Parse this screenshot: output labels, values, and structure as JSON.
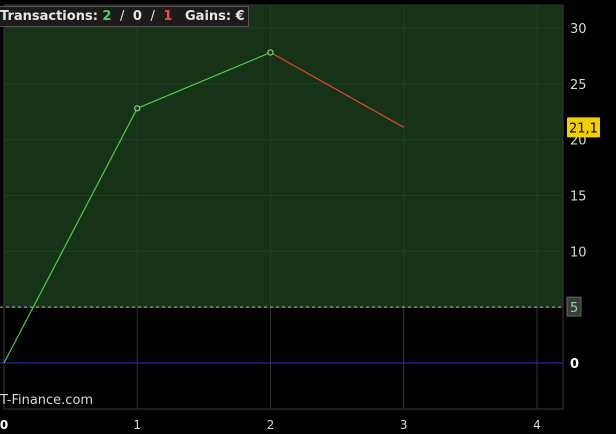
{
  "header": {
    "transactions_label": "Transactions:",
    "wins": "2",
    "neutral": "0",
    "losses": "1",
    "separator": "/",
    "gains_label": "Gains:",
    "gains_value": "€"
  },
  "watermark": "T-Finance.com",
  "chart_data": {
    "type": "line",
    "x": [
      0,
      1,
      2,
      3
    ],
    "y": [
      0,
      22.8,
      27.8,
      21.1
    ],
    "segment_colors": [
      "#4ccc4c",
      "#4ccc4c",
      "#e04a2a"
    ],
    "markers_at": [
      1,
      2
    ],
    "last_value_label": "21,1",
    "threshold": 5,
    "threshold_label": "5",
    "zero_line": 0,
    "xlim": [
      0,
      4.2
    ],
    "ylim": [
      -4.2,
      32
    ],
    "x_ticks": [
      0,
      1,
      2,
      3,
      4
    ],
    "x_tick_labels": [
      "0",
      "1",
      "2",
      "3",
      "4"
    ],
    "y_ticks": [
      0,
      5,
      10,
      15,
      20,
      25,
      30
    ],
    "y_tick_labels": [
      "0",
      "",
      "10",
      "15",
      "20",
      "25",
      "30"
    ],
    "grid": true,
    "colors": {
      "above_threshold_fill": "#173317",
      "below_threshold_fill": "#000000",
      "grid": "#2c3a2c",
      "zero_line": "#2a2ad8",
      "axis_text": "#d8d8d8",
      "last_value_bg": "#f2d000",
      "threshold_label_bg": "#3a3a3a",
      "threshold_line": "#bfbfbf"
    }
  }
}
